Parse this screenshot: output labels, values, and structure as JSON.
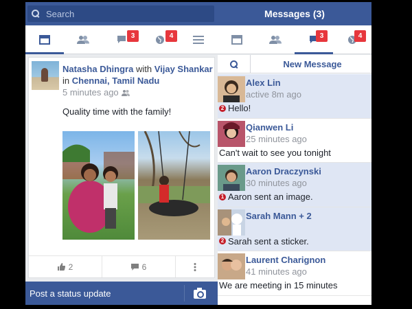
{
  "topbar": {
    "search_placeholder": "Search",
    "messages_title": "Messages (3)"
  },
  "nav_left": [
    {
      "icon": "news-feed-icon",
      "active": true
    },
    {
      "icon": "friends-icon"
    },
    {
      "icon": "messages-icon",
      "badge": "3"
    },
    {
      "icon": "globe-icon",
      "badge": "4"
    },
    {
      "icon": "menu-icon"
    }
  ],
  "nav_right": [
    {
      "icon": "news-feed-icon"
    },
    {
      "icon": "friends-icon"
    },
    {
      "icon": "messages-icon",
      "badge": "3",
      "active": true
    },
    {
      "icon": "globe-icon",
      "badge": "4"
    }
  ],
  "post": {
    "author": "Natasha Dhingra",
    "with_word": "with",
    "tagged": "Vijay Shankar",
    "in_word": "in",
    "location": "Chennai, Tamil Nadu",
    "time": "5 minutes ago",
    "text": "Quality time with the family!",
    "likes": "2",
    "comments": "6"
  },
  "statusbar": {
    "label": "Post a status update"
  },
  "messages": {
    "new_message_label": "New Message",
    "conversations": [
      {
        "name": "Alex Lin",
        "status": "active 8m ago",
        "preview": "Hello!",
        "unread_count": "2",
        "unread": true
      },
      {
        "name": "Qianwen  Li",
        "status": "25 minutes ago",
        "preview": "Can't wait to see you tonight",
        "unread_count": "",
        "unread": false
      },
      {
        "name": "Aaron Draczynski",
        "status": "30 minutes ago",
        "preview": "Aaron sent an image.",
        "unread_count": "1",
        "unread": true
      },
      {
        "name": "Sarah Mann + 2",
        "status": "",
        "preview": "Sarah sent a sticker.",
        "unread_count": "2",
        "unread": true
      },
      {
        "name": "Laurent Charignon",
        "status": "41 minutes ago",
        "preview": "We are meeting in 15 minutes",
        "unread_count": "",
        "unread": false
      }
    ]
  },
  "colors": {
    "brand_blue": "#3b5998",
    "badge_red": "#e7373d",
    "unread_bg": "#dfe6f4"
  }
}
